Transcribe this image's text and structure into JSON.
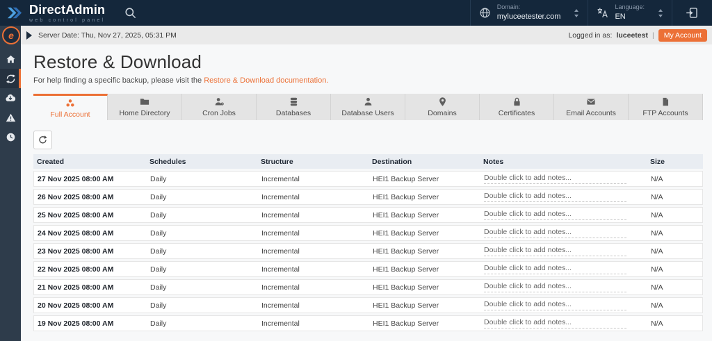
{
  "topbar": {
    "brand_name": "DirectAdmin",
    "brand_tagline": "web control panel",
    "domain_label": "Domain:",
    "domain_value": "myluceetester.com",
    "language_label": "Language:",
    "language_value": "EN"
  },
  "statusbar": {
    "server_date": "Server Date: Thu, Nov 27, 2025, 05:31 PM",
    "logged_in_prefix": "Logged in as:",
    "username": "luceetest",
    "separator": "|",
    "my_account_label": "My Account"
  },
  "sidebar": {
    "items": [
      {
        "icon": "home-icon",
        "active": false
      },
      {
        "icon": "restore-icon",
        "active": true
      },
      {
        "icon": "cloud-download-icon",
        "active": false
      },
      {
        "icon": "warning-icon",
        "active": false
      },
      {
        "icon": "clock-icon",
        "active": false
      }
    ]
  },
  "page": {
    "title": "Restore & Download",
    "help_text_prefix": "For help finding a specific backup, please visit the",
    "help_link_text": "Restore & Download documentation."
  },
  "tabs": [
    {
      "label": "Full Account",
      "icon": "full-account-icon",
      "active": true
    },
    {
      "label": "Home Directory",
      "icon": "folder-icon",
      "active": false
    },
    {
      "label": "Cron Jobs",
      "icon": "cron-icon",
      "active": false
    },
    {
      "label": "Databases",
      "icon": "database-icon",
      "active": false
    },
    {
      "label": "Database Users",
      "icon": "user-icon",
      "active": false
    },
    {
      "label": "Domains",
      "icon": "pin-icon",
      "active": false
    },
    {
      "label": "Certificates",
      "icon": "lock-icon",
      "active": false
    },
    {
      "label": "Email Accounts",
      "icon": "envelope-icon",
      "active": false
    },
    {
      "label": "FTP Accounts",
      "icon": "file-icon",
      "active": false
    }
  ],
  "table": {
    "headers": [
      "Created",
      "Schedules",
      "Structure",
      "Destination",
      "Notes",
      "Size"
    ],
    "notes_placeholder": "Double click to add notes...",
    "rows": [
      {
        "created": "27 Nov 2025 08:00 AM",
        "schedules": "Daily",
        "structure": "Incremental",
        "destination": "HEI1 Backup Server",
        "size": "N/A"
      },
      {
        "created": "26 Nov 2025 08:00 AM",
        "schedules": "Daily",
        "structure": "Incremental",
        "destination": "HEI1 Backup Server",
        "size": "N/A"
      },
      {
        "created": "25 Nov 2025 08:00 AM",
        "schedules": "Daily",
        "structure": "Incremental",
        "destination": "HEI1 Backup Server",
        "size": "N/A"
      },
      {
        "created": "24 Nov 2025 08:00 AM",
        "schedules": "Daily",
        "structure": "Incremental",
        "destination": "HEI1 Backup Server",
        "size": "N/A"
      },
      {
        "created": "23 Nov 2025 08:00 AM",
        "schedules": "Daily",
        "structure": "Incremental",
        "destination": "HEI1 Backup Server",
        "size": "N/A"
      },
      {
        "created": "22 Nov 2025 08:00 AM",
        "schedules": "Daily",
        "structure": "Incremental",
        "destination": "HEI1 Backup Server",
        "size": "N/A"
      },
      {
        "created": "21 Nov 2025 08:00 AM",
        "schedules": "Daily",
        "structure": "Incremental",
        "destination": "HEI1 Backup Server",
        "size": "N/A"
      },
      {
        "created": "20 Nov 2025 08:00 AM",
        "schedules": "Daily",
        "structure": "Incremental",
        "destination": "HEI1 Backup Server",
        "size": "N/A"
      },
      {
        "created": "19 Nov 2025 08:00 AM",
        "schedules": "Daily",
        "structure": "Incremental",
        "destination": "HEI1 Backup Server",
        "size": "N/A"
      }
    ]
  },
  "colors": {
    "accent": "#EC7036",
    "topbar_bg": "#14273B",
    "sidebar_bg": "#2E3C4B"
  }
}
